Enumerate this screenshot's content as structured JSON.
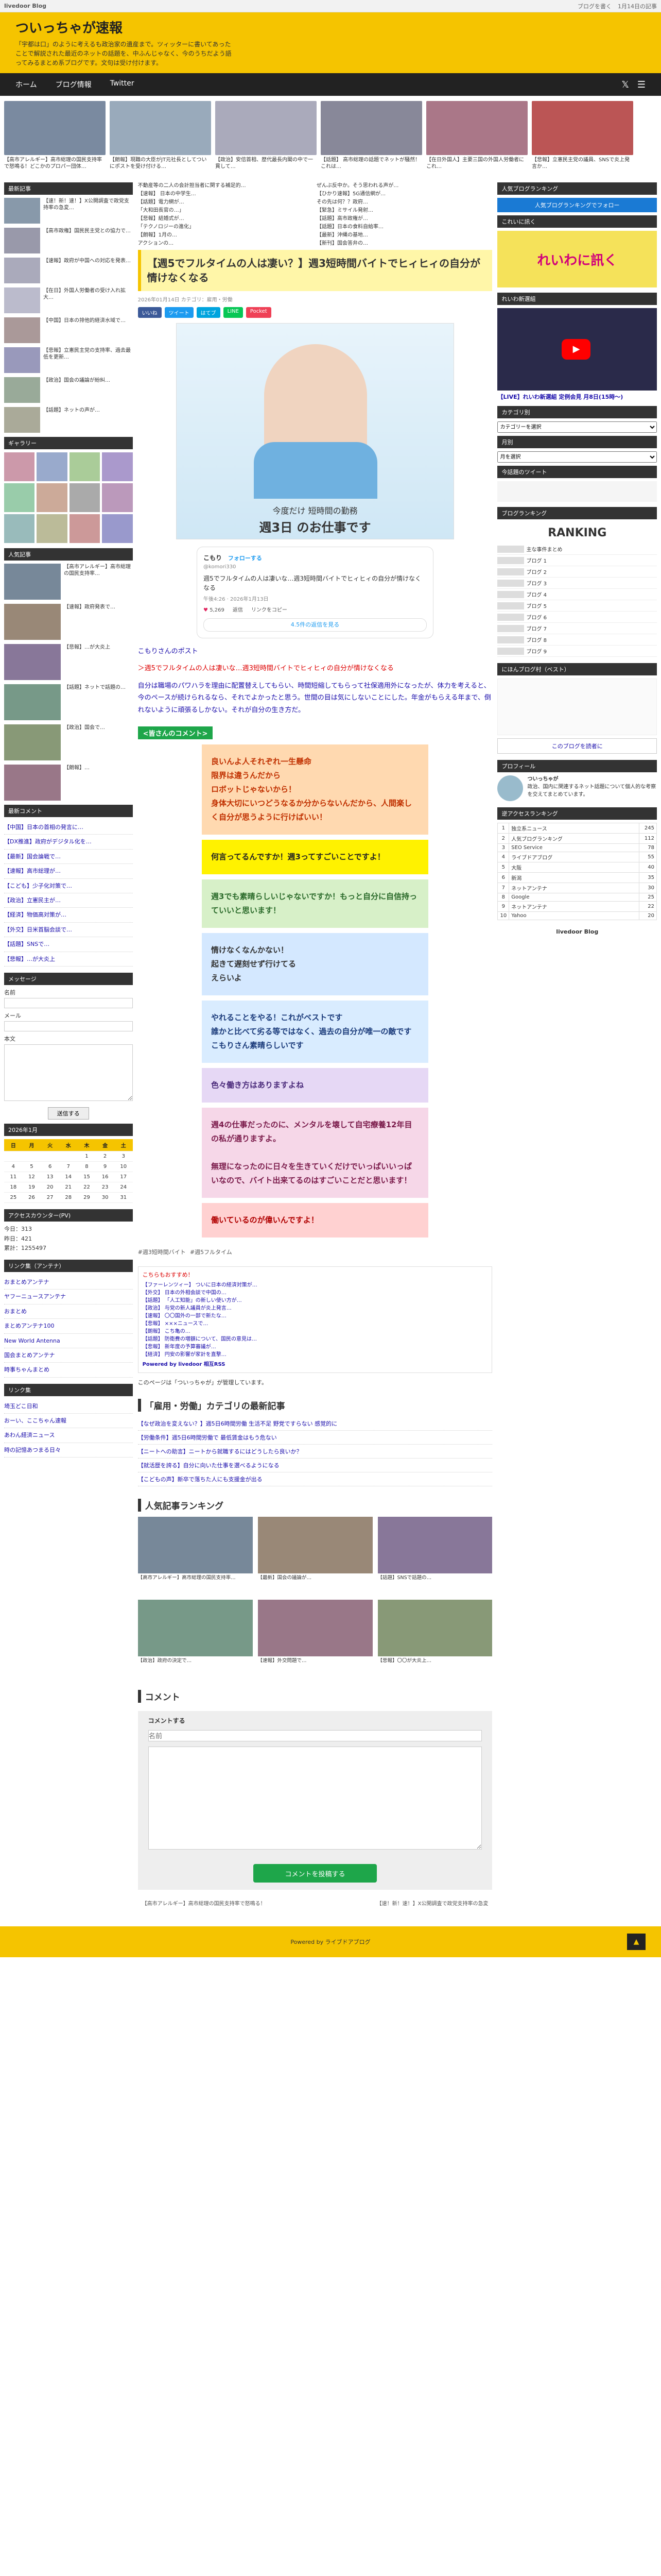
{
  "topbar": {
    "brand": "livedoor Blog",
    "links": [
      "ブログを書く",
      "1月14日の記事"
    ]
  },
  "site": {
    "title": "ついっちゃが速報",
    "desc": "「宇都は口」のように考えるも政治家の遺産まで。ツィッターに書いてあったことで解説された最近のネットの話題を、中ふんじゃなく、今のうちだよう語ってみるまとめ系ブログです。文句は受け付けます。"
  },
  "nav": {
    "items": [
      "ホーム",
      "ブログ情報",
      "Twitter"
    ]
  },
  "strip": [
    {
      "cap": "【高市アレルギー】高市総理の国民支持率で怒鳴る！どこかのプロパー団体…",
      "c": "#7a8aa0"
    },
    {
      "cap": "【朗報】現職の大臣がJT元社長としてついにポストを受け付ける…",
      "c": "#9ab"
    },
    {
      "cap": "【政治】安倍首相、歴代最長内閣の中で一貫して…",
      "c": "#aab"
    },
    {
      "cap": "【話題】 高市総理の話題でネットが騒然！これは…",
      "c": "#889"
    },
    {
      "cap": "【在日外国人】主要三国の外国人労働者にこれ…",
      "c": "#a78"
    },
    {
      "cap": "【悲報】立憲民主党の議員、SNSで炎上発言か…",
      "c": "#b55"
    }
  ],
  "left": {
    "new_title": "最新記事",
    "topitems": [
      {
        "t": "【速！新！速！】X公開調査で政党支持率の急変…",
        "c": "#8899aa"
      },
      {
        "t": "【高市政権】国民民主党との協力で…",
        "c": "#99a"
      },
      {
        "t": "【速報】政府が中国への対応を発表…",
        "c": "#aab"
      },
      {
        "t": "【在日】外国人労働者の受け入れ拡大…",
        "c": "#bbc"
      },
      {
        "t": "【中国】日本の排他的経済水域で…",
        "c": "#a99"
      },
      {
        "t": "【悲報】立憲民主党の支持率、過去最低を更新…",
        "c": "#99b"
      },
      {
        "t": "【政治】国会の議論が紛糾…",
        "c": "#9a9"
      },
      {
        "t": "【話題】ネットの声が…",
        "c": "#aa9"
      }
    ],
    "gallery_title": "ギャラリー",
    "gallery": [
      "#c9a",
      "#9ac",
      "#ac9",
      "#a9c",
      "#9ca",
      "#ca9",
      "#aaa",
      "#b9b",
      "#9bb",
      "#bb9",
      "#c99",
      "#99c"
    ],
    "pop_title": "人気記事",
    "pop": [
      {
        "t": "【高市アレルギー】高市総理の国民支持率…",
        "c": "#789"
      },
      {
        "t": "【速報】政府発表で…",
        "c": "#987"
      },
      {
        "t": "【悲報】…が大炎上",
        "c": "#879"
      },
      {
        "t": "【話題】ネットで話題の…",
        "c": "#798"
      },
      {
        "t": "【政治】国会で…",
        "c": "#897"
      },
      {
        "t": "【朗報】…",
        "c": "#978"
      }
    ],
    "recent_title": "最新コメント",
    "recent": [
      "【中国】日本の首相の発言に…",
      "【DX推進】政府がデジタル化を…",
      "【最新】国会論戦で…",
      "【速報】高市総理が…",
      "【こども】少子化対策で…",
      "【政治】立憲民主が…",
      "【経済】物価高対策が…",
      "【外交】日米首脳会談で…",
      "【話題】SNSで…",
      "【悲報】…が大炎上"
    ],
    "msg_title": "メッセージ",
    "form": {
      "name": "名前",
      "mail": "メール",
      "body": "本文",
      "submit": "送信する"
    },
    "cal_title": "2026年1月",
    "cal_head": [
      "日",
      "月",
      "火",
      "水",
      "木",
      "金",
      "土"
    ],
    "cal_rows": [
      [
        "",
        "",
        "",
        "",
        "1",
        "2",
        "3"
      ],
      [
        "4",
        "5",
        "6",
        "7",
        "8",
        "9",
        "10"
      ],
      [
        "11",
        "12",
        "13",
        "14",
        "15",
        "16",
        "17"
      ],
      [
        "18",
        "19",
        "20",
        "21",
        "22",
        "23",
        "24"
      ],
      [
        "25",
        "26",
        "27",
        "28",
        "29",
        "30",
        "31"
      ]
    ],
    "count_title": "アクセスカウンター(PV)",
    "count": [
      "今日：313",
      "昨日：421",
      "累計：1255497"
    ],
    "links_title": "リンク集（アンテナ）",
    "links": [
      "おまとめアンテナ",
      "ヤフーニュースアンテナ",
      "おまとめ",
      "まとめアンテナ100",
      "New World Antenna",
      "国会まとめアンテナ",
      "時事ちゃんまとめ"
    ],
    "links2_title": "リンク集",
    "links2": [
      "埼玉どこ日和",
      "おーい、ここちゃん速報",
      "あわん経済ニュース",
      "時の記憶あつまる日々"
    ]
  },
  "article": {
    "feed": [
      "不動産等の二人の会計担当者に関する補足的…",
      "ぜんぶ反中か。そう思われる声が…",
      "【速報】 日本の中学生…",
      "【ひかり速報】5G通信網が…",
      "【話題】電力網が…",
      "その先は何？？政府…",
      "「大和田長官の…」",
      "【緊急】ミサイル発射…",
      "【悲報】結婚式が…",
      "【話題】高市政権が…",
      "「テクノロジーの進化」",
      "【話題】日本の食料自給率…",
      "【朗報】1月の…",
      "【最新】沖縄の基地…",
      "アクションの…",
      "【新刊】国会答弁の…"
    ],
    "title": "【週5でフルタイムの人は凄い？】週3短時間バイトでヒィヒィの自分が情けなくなる",
    "meta": "2026年01月14日  カテゴリ：雇用・労働",
    "share": [
      {
        "l": "いいね",
        "c": "#3b5998"
      },
      {
        "l": "ツイート",
        "c": "#1d9bf0"
      },
      {
        "l": "はてブ",
        "c": "#00a4de"
      },
      {
        "l": "LINE",
        "c": "#06c755"
      },
      {
        "l": "Pocket",
        "c": "#ef4056"
      }
    ],
    "hero_cap1": "今度だけ 短時間の勤務",
    "hero_cap2": "週3日 のお仕事です",
    "tweet": {
      "name": "こもり",
      "handle": "@komori330",
      "follow": "フォローする",
      "body": "週5でフルタイムの人は凄いな…週3短時間バイトでヒィヒィの自分が情けなくなる",
      "time": "午後4:26 · 2026年1月13日",
      "likes": "5,269",
      "reply": "返信",
      "copy": "リンクをコピー",
      "more": "4.5件の返信を見る"
    },
    "intro": "こもりさんのポスト",
    "quote": "＞週5でフルタイムの人は凄いな…週3短時間バイトでヒィヒィの自分が情けなくなる",
    "para": "自分は職場のパワハラを理由に配置替えしてもらい、時間短縮してもらって社保適用外になったが、体力を考えると、今のペースが続けられるなら、それでよかったと思う。世間の目は気にしないことにした。年金がもらえる年まで、倒れないように頑張るしかない。それが自分の生き方だ。",
    "ctitle": "<皆さんのコメント>",
    "comments": [
      {
        "t": "良いんよ人それぞれ一生懸命\n限界は違うんだから\nロボットじゃないから！\n身体大切にいつどうなるか分からないんだから、人間楽しく自分が思うように行けばいい！",
        "bg": "#ffd9b0",
        "c": "#c03000"
      },
      {
        "t": "何言ってるんですか！週3ってすごいことですよ！",
        "bg": "#fff200",
        "c": "#222"
      },
      {
        "t": "週3でも素晴らしいじゃないですか！もっと自分に自信持っていいと思います！",
        "bg": "#d7f0c8",
        "c": "#2a6a2a"
      },
      {
        "t": "情けなくなんかない！\n起きて遅刻せず行けてる\nえらいよ",
        "bg": "#d4e8ff",
        "c": "#333"
      },
      {
        "t": "やれることをやる！これがベストです\n誰かと比べて劣る等ではなく、過去の自分が唯一の敵です\nこもりさん素晴らしいです",
        "bg": "#d9ecff",
        "c": "#1a3a7a"
      },
      {
        "t": "色々働き方はありますよね",
        "bg": "#e6d8f5",
        "c": "#4a2a7a"
      },
      {
        "t": "週4の仕事だったのに、メンタルを壊して自宅療養12年目の私が通りますよ。\n\n無理になったのに日々を生きていくだけでいっぱいいっぱいなので、バイト出来てるのはすごいことだと思います！",
        "bg": "#f6d7e8",
        "c": "#7a1a4a"
      },
      {
        "t": "働いているのが偉いんですよ！",
        "bg": "#ffd1d1",
        "c": "#b00000"
      }
    ],
    "tags": [
      "#週3短時間バイト",
      "#週5フルタイム"
    ],
    "rss_head": "こちらもおすすめ！",
    "rss": [
      "【ファーレンツィー】 ついに日本の経済対策が…",
      "【外交】 日本の外相会談で中国の…",
      "【話題】 「人工知能」の新しい使い方が…",
      "【政治】 与党の新人議員が炎上発言…",
      "【速報】 〇〇国外の一部で新たな…",
      "【悲報】 ×××ニュースで…",
      "【朗報】 こち亀の…",
      "【話題】 防衛費の増額について、国民の意見は…",
      "【悲報】 新年度の予算審議が…",
      "【経済】 円安の影響が家計を直撃…"
    ],
    "rss_footer": "Powered by livedoor 相互RSS",
    "owner": "このページは「ついっちゃが」が管理しています。",
    "cat_title": "「雇用・労働」カテゴリの最新記事",
    "cat": [
      "【なぜ政治を変えない？】週5日6時間労働 生活不足 野党ですらない 感覚的に",
      "【労働条件】週5日6時間労働で 最低賃金はもう危ない",
      "【ニートへの助言】ニートから就職するにはどうしたら良いか？",
      "【就活歴を誇る】自分に向いた仕事を選べるようになる",
      "【こどもの声】新卒で落ちた人にも支援金が出る"
    ],
    "rank_title": "人気記事ランキング",
    "rank": [
      {
        "cap": "【高市アレルギー】高市総理の国民支持率…",
        "c": "#778899"
      },
      {
        "cap": "【最新】国会の議論が…",
        "c": "#998877"
      },
      {
        "cap": "【話題】SNSで話題の…",
        "c": "#887799"
      },
      {
        "cap": "【政治】政府の決定で…",
        "c": "#779988"
      },
      {
        "cap": "【速報】外交問題で…",
        "c": "#997788"
      },
      {
        "cap": "【悲報】〇〇が大炎上…",
        "c": "#889977"
      }
    ],
    "comment_title": "コメント",
    "commentform_title": "コメントする",
    "cf_name": "名前",
    "cf_btn": "コメントを投稿する",
    "prev": "【高市アレルギー】高市総理の国民支持率で怒鳴る！",
    "next": "【速！新！速！】X公開調査で政党支持率の急変"
  },
  "right": {
    "rank_title": "人気ブログランキング",
    "rank_btn": "人気ブログランキングでフォロー",
    "ad_title": "これいに訊く",
    "ad_text": "れいわに訊く",
    "video_title": "れいわ新選組",
    "video_cap": "【LIVE】れいわ新選組 定例会見 月8日(15時〜)",
    "cat_title": "カテゴリ別",
    "cat_sel": "カテゴリーを選択",
    "month_title": "月別",
    "month_sel": "月を選択",
    "search_title": "今話題のツイート",
    "ranking_title": "ブログランキング",
    "ranking_logo": "RANKING",
    "ranking_rows": [
      "主な事件まとめ",
      "ブログ 1",
      "ブログ 2",
      "ブログ 3",
      "ブログ 4",
      "ブログ 5",
      "ブログ 6",
      "ブログ 7",
      "ブログ 8",
      "ブログ 9"
    ],
    "rss_title": "にほんブログ村（ベスト）",
    "rss_btn": "このブログを読者に",
    "profile_title": "プロフィール",
    "profile_name": "ついっちゃが",
    "profile_text": "政治、国内に関連するネット話題について個人的な考察を交えてまとめています。",
    "access_title": "逆アクセスランキング",
    "access": [
      [
        "1",
        "独立系ニュース",
        "245"
      ],
      [
        "2",
        "人気ブログランキング",
        "112"
      ],
      [
        "3",
        "SEO Service",
        "78"
      ],
      [
        "4",
        "ライブドアブログ",
        "55"
      ],
      [
        "5",
        "大阪",
        "40"
      ],
      [
        "6",
        "新潟",
        "35"
      ],
      [
        "7",
        "ネットアンテナ",
        "30"
      ],
      [
        "8",
        "Google",
        "25"
      ],
      [
        "9",
        "ネットアンテナ",
        "22"
      ],
      [
        "10",
        "Yahoo",
        "20"
      ]
    ],
    "footer_logo": "livedoor Blog"
  },
  "footer": {
    "text": "Powered by ライブドアブログ",
    "top": "▲"
  }
}
